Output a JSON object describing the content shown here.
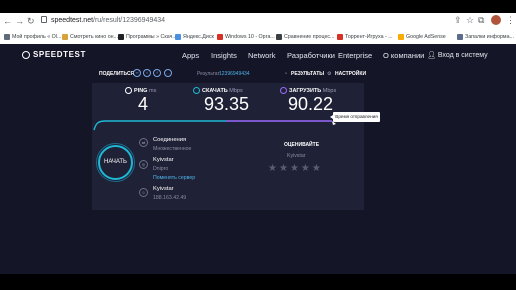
{
  "browser": {
    "url_host": "speedtest.net",
    "url_path": "/ru/result/12396949434",
    "bookmarks": [
      {
        "label": "Мой профиль « Ol...",
        "color": "#5f6b7a"
      },
      {
        "label": "Смотреть кино он...",
        "color": "#d6a33b"
      },
      {
        "label": "Программы » Скач...",
        "color": "#202124"
      },
      {
        "label": "Яндекс.Диск",
        "color": "#4a90e2"
      },
      {
        "label": "Windows 10 - Орга...",
        "color": "#d93025"
      },
      {
        "label": "Сравнение процес...",
        "color": "#3c4043"
      },
      {
        "label": "Торрент-Игруха - ...",
        "color": "#d93025"
      },
      {
        "label": "Google AdSense",
        "color": "#f9ab00"
      },
      {
        "label": "Запалки информа...",
        "color": "#5a6b8c"
      }
    ]
  },
  "header": {
    "brand": "SPEEDTEST",
    "nav": [
      "Apps",
      "Insights",
      "Network",
      "Разработчики",
      "Enterprise",
      "О компании"
    ],
    "login": "Вход в систему"
  },
  "subheader": {
    "share_label": "ПОДЕЛИТЬСЯ",
    "result_label": "Результат",
    "result_id": "12396949434",
    "results_link": "РЕЗУЛЬТАТЫ",
    "settings_link": "НАСТРОЙКИ"
  },
  "metrics": {
    "ping": {
      "label": "PING",
      "unit": "ms",
      "value": "4"
    },
    "download": {
      "label": "СКАЧАТЬ",
      "unit": "Mbps",
      "value": "93.35"
    },
    "upload": {
      "label": "ЗАГРУЗИТЬ",
      "unit": "Mbps",
      "value": "90.22"
    }
  },
  "tooltip": "Время отправления",
  "go_button": "НАЧАТЬ",
  "connection": {
    "title": "Соединения",
    "value": "Множественное"
  },
  "server": {
    "isp": "Kyivstar",
    "city": "Dnipro",
    "change_link": "Поменять сервер"
  },
  "client": {
    "isp": "Kyivstar",
    "ip": "188.163.42.49"
  },
  "rating": {
    "title": "ОЦЕНИВАЙТЕ",
    "isp": "Kyivstar",
    "stars": 0,
    "max_stars": 5
  },
  "colors": {
    "page_bg": "#141526",
    "card_bg": "#1f2136",
    "accent_cyan": "#1fb9d6",
    "accent_purple": "#9c6bff",
    "link_blue": "#4fb4ea"
  }
}
